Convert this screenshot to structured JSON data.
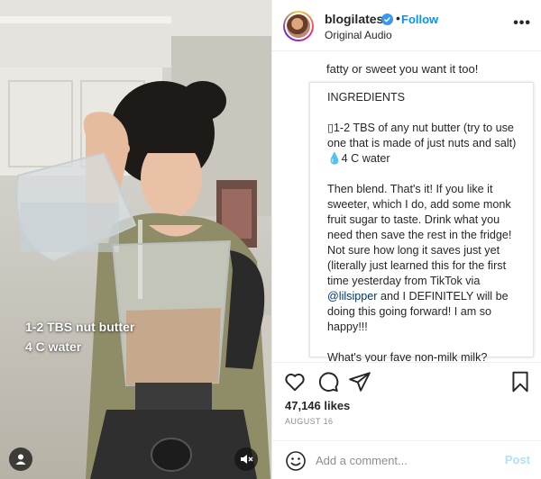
{
  "video": {
    "overlay_lines": [
      "1-2 TBS nut butter",
      "4 C water"
    ],
    "icons": {
      "user_tag": "user-icon",
      "mute": "speaker-muted-icon"
    }
  },
  "post": {
    "username": "blogilates",
    "follow_label": "Follow",
    "separator": "•",
    "audio_label": "Original Audio",
    "more_label": "•••",
    "caption_top": [
      "fatty or sweet you want it too!"
    ],
    "ingredients_title": "INGREDIENTS",
    "ingredient_lines": [
      "▯1-2 TBS of any nut butter (try to use",
      "one that is made of just nuts and salt)",
      "💧4 C water"
    ],
    "body_lines_1": [
      "Then blend. That's it! If you like it",
      "sweeter, which I do, add some monk",
      "fruit sugar to taste. Drink what you",
      "need then save the rest in the fridge!",
      "Not sure how long it saves just yet",
      "(literally just learned this for the first",
      "time yesterday from TikTok via"
    ],
    "mention": "@lilsipper",
    "mention_suffix": " and I DEFINITELY will be",
    "body_lines_2": [
      "doing this going forward! I am so",
      "happy!!!"
    ],
    "question": "What's your fave non-milk milk?",
    "likes": "47,146 likes",
    "date": "AUGUST 16",
    "comment_placeholder": "Add a comment...",
    "post_label": "Post"
  },
  "colors": {
    "accent_blue": "#0095f6",
    "underline_red": "#d0161b",
    "post_disabled": "#b2dffc"
  }
}
